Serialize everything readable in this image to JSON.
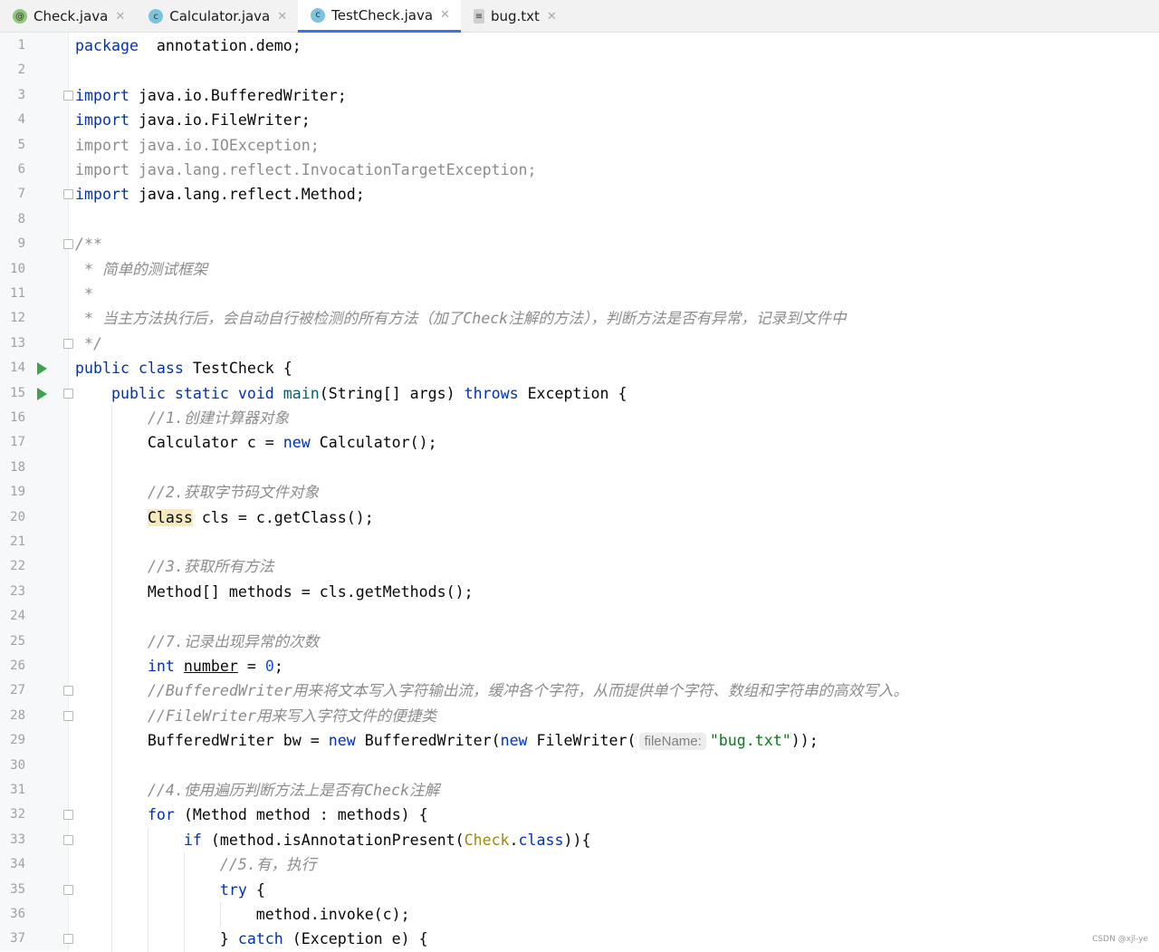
{
  "tabs": [
    {
      "label": "Check.java",
      "icon": "annotation-icon",
      "color": "#8fc67a",
      "glyph": "@",
      "active": false
    },
    {
      "label": "Calculator.java",
      "icon": "class-icon",
      "color": "#7cc3e0",
      "glyph": "c",
      "active": false
    },
    {
      "label": "TestCheck.java",
      "icon": "runnable-class-icon",
      "color": "#7cc3e0",
      "glyph": "c",
      "active": true
    },
    {
      "label": "bug.txt",
      "icon": "text-file-icon",
      "color": "#cfcfcf",
      "glyph": "≡",
      "active": false
    }
  ],
  "colors": {
    "keyword": "#0033b3",
    "comment": "#8c8c8c",
    "string": "#067d17",
    "number": "#1750eb",
    "run": "#3fa34d",
    "tab_active": "#3574f0"
  },
  "run_lines": [
    14,
    15
  ],
  "fold_lines": [
    3,
    7,
    9,
    13,
    15,
    27,
    28,
    32,
    33,
    35,
    37
  ],
  "lines": [
    [
      [
        "kw",
        "package"
      ],
      [
        "",
        "  annotation.demo;"
      ]
    ],
    [],
    [
      [
        "kw",
        "import"
      ],
      [
        "",
        " java.io.BufferedWriter;"
      ]
    ],
    [
      [
        "kw",
        "import"
      ],
      [
        "",
        " java.io.FileWriter;"
      ]
    ],
    [
      [
        "unused",
        "import java.io.IOException;"
      ]
    ],
    [
      [
        "unused",
        "import java.lang.reflect.InvocationTargetException;"
      ]
    ],
    [
      [
        "kw",
        "import"
      ],
      [
        "",
        " java.lang.reflect.Method;"
      ]
    ],
    [],
    [
      [
        "cm",
        "/**"
      ]
    ],
    [
      [
        "cm",
        " * 简单的测试框架"
      ]
    ],
    [
      [
        "cm",
        " *"
      ]
    ],
    [
      [
        "cm",
        " * 当主方法执行后，会自动自行被检测的所有方法（加了Check注解的方法），判断方法是否有异常，记录到文件中"
      ]
    ],
    [
      [
        "cm",
        " */"
      ]
    ],
    [
      [
        "kw",
        "public class"
      ],
      [
        "",
        " TestCheck {"
      ]
    ],
    [
      [
        "",
        "    "
      ],
      [
        "kw",
        "public static void"
      ],
      [
        "",
        " "
      ],
      [
        "fn",
        "main"
      ],
      [
        "",
        "(String[] args) "
      ],
      [
        "kw",
        "throws"
      ],
      [
        "",
        " Exception {"
      ]
    ],
    [
      [
        "",
        "        "
      ],
      [
        "cm",
        "//1.创建计算器对象"
      ]
    ],
    [
      [
        "",
        "        Calculator c = "
      ],
      [
        "kw",
        "new"
      ],
      [
        "",
        " Calculator();"
      ]
    ],
    [],
    [
      [
        "",
        "        "
      ],
      [
        "cm",
        "//2.获取字节码文件对象"
      ]
    ],
    [
      [
        "",
        "        "
      ],
      [
        "hl",
        "Class"
      ],
      [
        "",
        " cls = c.getClass();"
      ]
    ],
    [],
    [
      [
        "",
        "        "
      ],
      [
        "cm",
        "//3.获取所有方法"
      ]
    ],
    [
      [
        "",
        "        Method[] methods = cls.getMethods();"
      ]
    ],
    [],
    [
      [
        "",
        "        "
      ],
      [
        "cm",
        "//7.记录出现异常的次数"
      ]
    ],
    [
      [
        "",
        "        "
      ],
      [
        "kw",
        "int"
      ],
      [
        "",
        " "
      ],
      [
        "ul",
        "number"
      ],
      [
        "",
        " = "
      ],
      [
        "num",
        "0"
      ],
      [
        "",
        ";"
      ]
    ],
    [
      [
        "",
        "        "
      ],
      [
        "cm",
        "//BufferedWriter用来将文本写入字符输出流，缓冲各个字符，从而提供单个字符、数组和字符串的高效写入。"
      ]
    ],
    [
      [
        "",
        "        "
      ],
      [
        "cm",
        "//FileWriter用来写入字符文件的便捷类"
      ]
    ],
    [
      [
        "",
        "        BufferedWriter bw = "
      ],
      [
        "kw",
        "new"
      ],
      [
        "",
        " BufferedWriter("
      ],
      [
        "kw",
        "new"
      ],
      [
        "",
        " FileWriter("
      ],
      [
        "hint",
        "fileName:"
      ],
      [
        "str",
        "\"bug.txt\""
      ],
      [
        "",
        "));"
      ]
    ],
    [],
    [
      [
        "",
        "        "
      ],
      [
        "cm",
        "//4.使用遍历判断方法上是否有Check注解"
      ]
    ],
    [
      [
        "",
        "        "
      ],
      [
        "kw",
        "for"
      ],
      [
        "",
        " (Method method : methods) {"
      ]
    ],
    [
      [
        "",
        "            "
      ],
      [
        "kw",
        "if"
      ],
      [
        "",
        " (method.isAnnotationPresent("
      ],
      [
        "ann",
        "Check"
      ],
      [
        "",
        "."
      ],
      [
        "kw",
        "class"
      ],
      [
        "",
        "))"
      ],
      [
        "",
        "{"
      ]
    ],
    [
      [
        "",
        "                "
      ],
      [
        "cm",
        "//5.有，执行"
      ]
    ],
    [
      [
        "",
        "                "
      ],
      [
        "kw",
        "try"
      ],
      [
        "",
        " {"
      ]
    ],
    [
      [
        "",
        "                    method.invoke(c);"
      ]
    ],
    [
      [
        "",
        "                } "
      ],
      [
        "kw",
        "catch"
      ],
      [
        "",
        " (Exception e) {"
      ]
    ]
  ],
  "watermark": "CSDN @xjl-ye"
}
